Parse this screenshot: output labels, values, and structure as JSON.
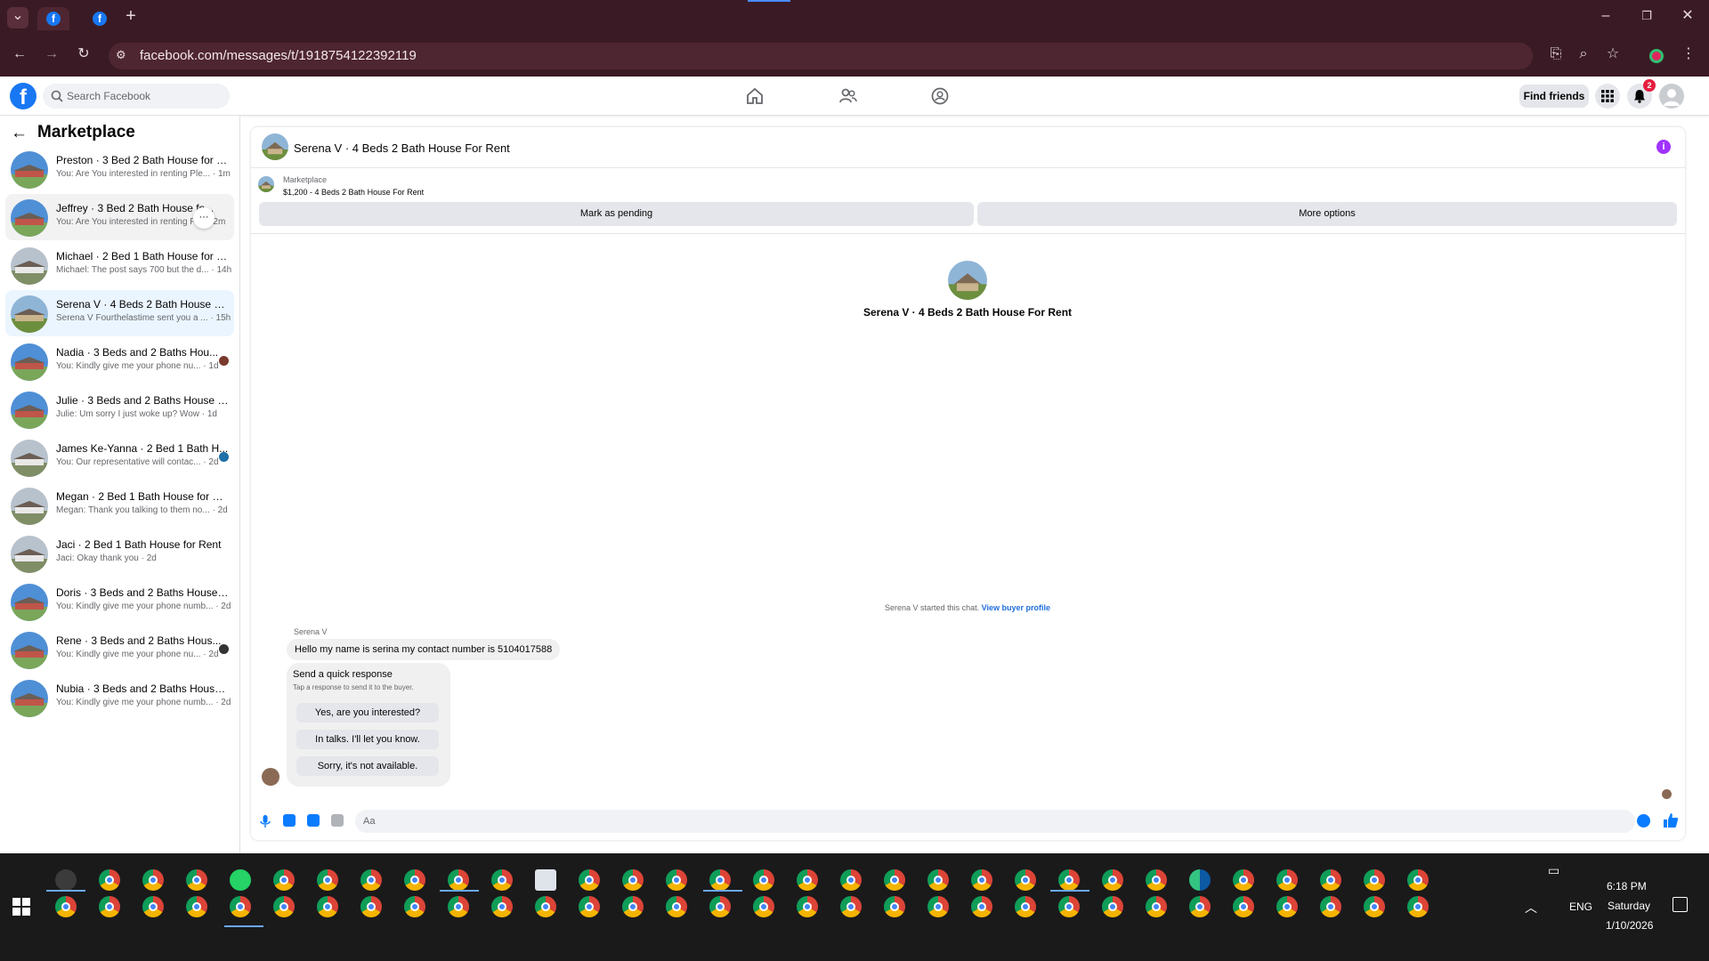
{
  "browser": {
    "url": "facebook.com/messages/t/1918754122392119",
    "new_tab_symbol": "+",
    "tab_icon_letter": "f"
  },
  "header": {
    "logo_letter": "f",
    "search_placeholder": "Search Facebook",
    "find_friends_label": "Find friends",
    "notification_count": "2"
  },
  "sidebar": {
    "title": "Marketplace",
    "conversations": [
      {
        "title": "Preston · 3 Bed 2 Bath House for R...",
        "preview": "You: Are You interested in renting Ple...",
        "time": "· 1m",
        "thumb": "blue",
        "dot": ""
      },
      {
        "title": "Jeffrey · 3 Bed 2 Bath House fo...",
        "preview": "You: Are You interested in renting Pl...",
        "time": "· 2m",
        "thumb": "blue",
        "dot": ""
      },
      {
        "title": "Michael · 2 Bed 1 Bath House for R...",
        "preview": "Michael: The post says 700 but the d...",
        "time": "· 14h",
        "thumb": "gray",
        "dot": ""
      },
      {
        "title": "Serena V · 4 Beds 2 Bath House Fo...",
        "preview": "Serena V Fourthelastime sent you a ...",
        "time": "· 15h",
        "thumb": "green",
        "dot": ""
      },
      {
        "title": "Nadia · 3 Beds and 2 Baths Hou...",
        "preview": "You: Kindly give me your phone nu...",
        "time": "· 1d",
        "thumb": "blue",
        "dot": "#7a3b2e"
      },
      {
        "title": "Julie · 3 Beds and 2 Baths House F...",
        "preview": "Julie: Um sorry I just woke up? Wow",
        "time": "· 1d",
        "thumb": "blue",
        "dot": ""
      },
      {
        "title": "James Ke-Yanna · 2 Bed 1 Bath H...",
        "preview": "You: Our representative will contac...",
        "time": "· 2d",
        "thumb": "gray",
        "dot": "#1f6fa8"
      },
      {
        "title": "Megan · 2 Bed 1 Bath House for Re...",
        "preview": "Megan: Thank you talking to them no...",
        "time": "· 2d",
        "thumb": "gray",
        "dot": ""
      },
      {
        "title": "Jaci · 2 Bed 1 Bath House for Rent",
        "preview": "Jaci: Okay thank you",
        "time": "· 2d",
        "thumb": "gray",
        "dot": ""
      },
      {
        "title": "Doris · 3 Beds and 2 Baths House F...",
        "preview": "You: Kindly give me your phone numb...",
        "time": "· 2d",
        "thumb": "blue",
        "dot": ""
      },
      {
        "title": "Rene · 3 Beds and 2 Baths Hous...",
        "preview": "You: Kindly give me your phone nu...",
        "time": "· 2d",
        "thumb": "blue",
        "dot": "#333333"
      },
      {
        "title": "Nubia · 3 Beds and 2 Baths House ...",
        "preview": "You: Kindly give me your phone numb...",
        "time": "· 2d",
        "thumb": "blue",
        "dot": ""
      }
    ],
    "more_symbol": "···"
  },
  "chat": {
    "title": "Serena V · 4 Beds 2 Bath House For Rent",
    "info_symbol": "i",
    "listing_source": "Marketplace",
    "listing_text": "$1,200 - 4 Beds 2 Bath House For Rent",
    "mark_pending_label": "Mark as pending",
    "more_options_label": "More options",
    "center_title": "Serena V · 4 Beds 2 Bath House For Rent",
    "started_text": "Serena V started this chat.",
    "buyer_profile_link": "View buyer profile",
    "sender_name": "Serena V",
    "message": "Hello my name is serina my contact number is 5104017588",
    "quick_title": "Send a quick response",
    "quick_sub": "Tap a response to send it to the buyer.",
    "quick_responses": [
      "Yes, are you interested?",
      "In talks. I'll let you know.",
      "Sorry, it's not available."
    ],
    "composer_placeholder": "Aa"
  },
  "taskbar": {
    "time": "6:18 PM",
    "day": "Saturday",
    "date": "1/10/2026",
    "language": "ENG"
  },
  "colors": {
    "brand": "#1877f2",
    "selected_row": "#ebf5ff",
    "browser_frame": "#3a1b25"
  }
}
